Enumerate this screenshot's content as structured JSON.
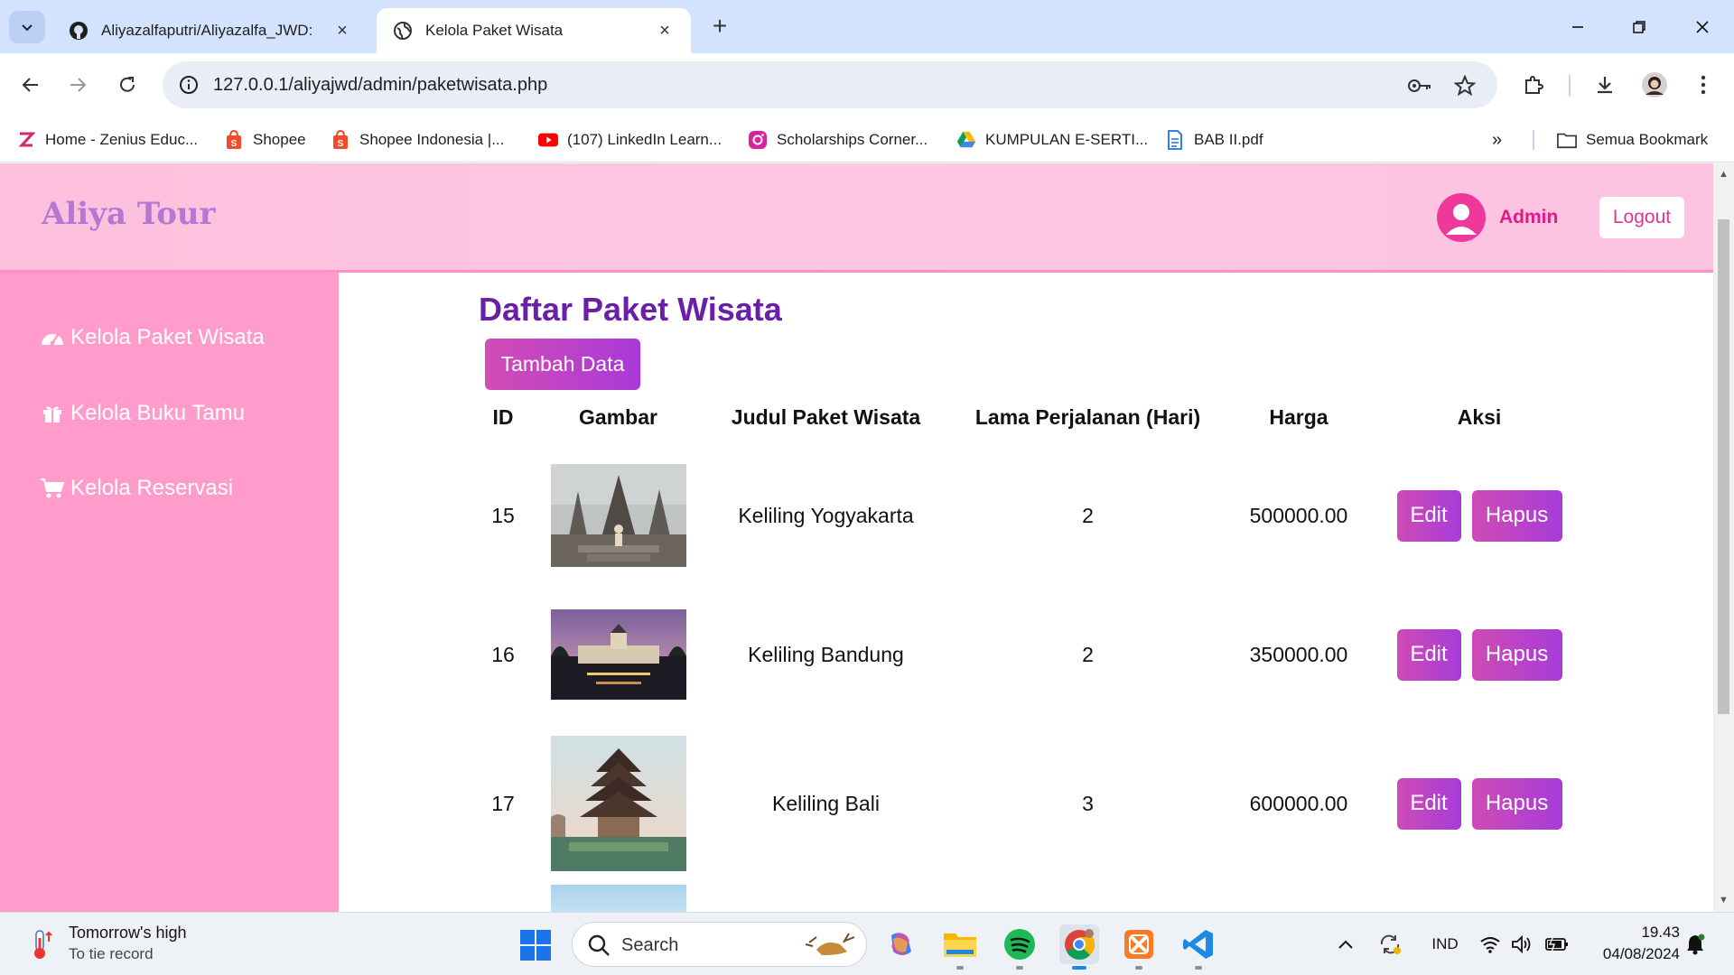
{
  "browser": {
    "tabs": [
      {
        "title": "Aliyazalfaputri/Aliyazalfa_JWD: ",
        "active": false
      },
      {
        "title": "Kelola Paket Wisata",
        "active": true
      }
    ],
    "url": "127.0.0.1/aliyajwd/admin/paketwisata.php",
    "bookmarks": [
      {
        "label": "Home - Zenius Educ...",
        "icon": "zenius-icon"
      },
      {
        "label": "Shopee",
        "icon": "shopee-icon"
      },
      {
        "label": "Shopee Indonesia |...",
        "icon": "shopee-icon"
      },
      {
        "label": "(107) LinkedIn Learn...",
        "icon": "youtube-icon"
      },
      {
        "label": "Scholarships Corner...",
        "icon": "instagram-icon"
      },
      {
        "label": "KUMPULAN E-SERTI...",
        "icon": "google-drive-icon"
      },
      {
        "label": "BAB II.pdf",
        "icon": "document-icon"
      }
    ],
    "all_bookmarks_label": "Semua Bookmark"
  },
  "site": {
    "brand": "Aliya Tour",
    "user_label": "Admin",
    "logout_label": "Logout",
    "colors": {
      "header": "#ffc7e2",
      "sidebar": "#ff9ccb",
      "accent": "#e5188a",
      "title": "#6a1fa8",
      "button": "#b93fcc"
    }
  },
  "sidebar": {
    "items": [
      {
        "label": "Kelola Paket Wisata",
        "icon": "dashboard-gauge-icon"
      },
      {
        "label": "Kelola Buku Tamu",
        "icon": "gift-icon"
      },
      {
        "label": "Kelola Reservasi",
        "icon": "shopping-cart-icon"
      }
    ]
  },
  "main": {
    "title": "Daftar Paket Wisata",
    "add_button": "Tambah Data",
    "columns": [
      "ID",
      "Gambar",
      "Judul Paket Wisata",
      "Lama Perjalanan (Hari)",
      "Harga",
      "Aksi"
    ],
    "rows": [
      {
        "id": "15",
        "image": "temple-photo",
        "judul": "Keliling Yogyakarta",
        "lama": "2",
        "harga": "500000.00"
      },
      {
        "id": "16",
        "image": "city-hall-photo",
        "judul": "Keliling Bandung",
        "lama": "2",
        "harga": "350000.00"
      },
      {
        "id": "17",
        "image": "bali-pagoda-photo",
        "judul": "Keliling Bali",
        "lama": "3",
        "harga": "600000.00"
      }
    ],
    "edit_label": "Edit",
    "delete_label": "Hapus"
  },
  "taskbar": {
    "weather_title": "Tomorrow's high",
    "weather_sub": "To tie record",
    "search_placeholder": "Search",
    "language": "IND",
    "time": "19.43",
    "date": "04/08/2024"
  }
}
